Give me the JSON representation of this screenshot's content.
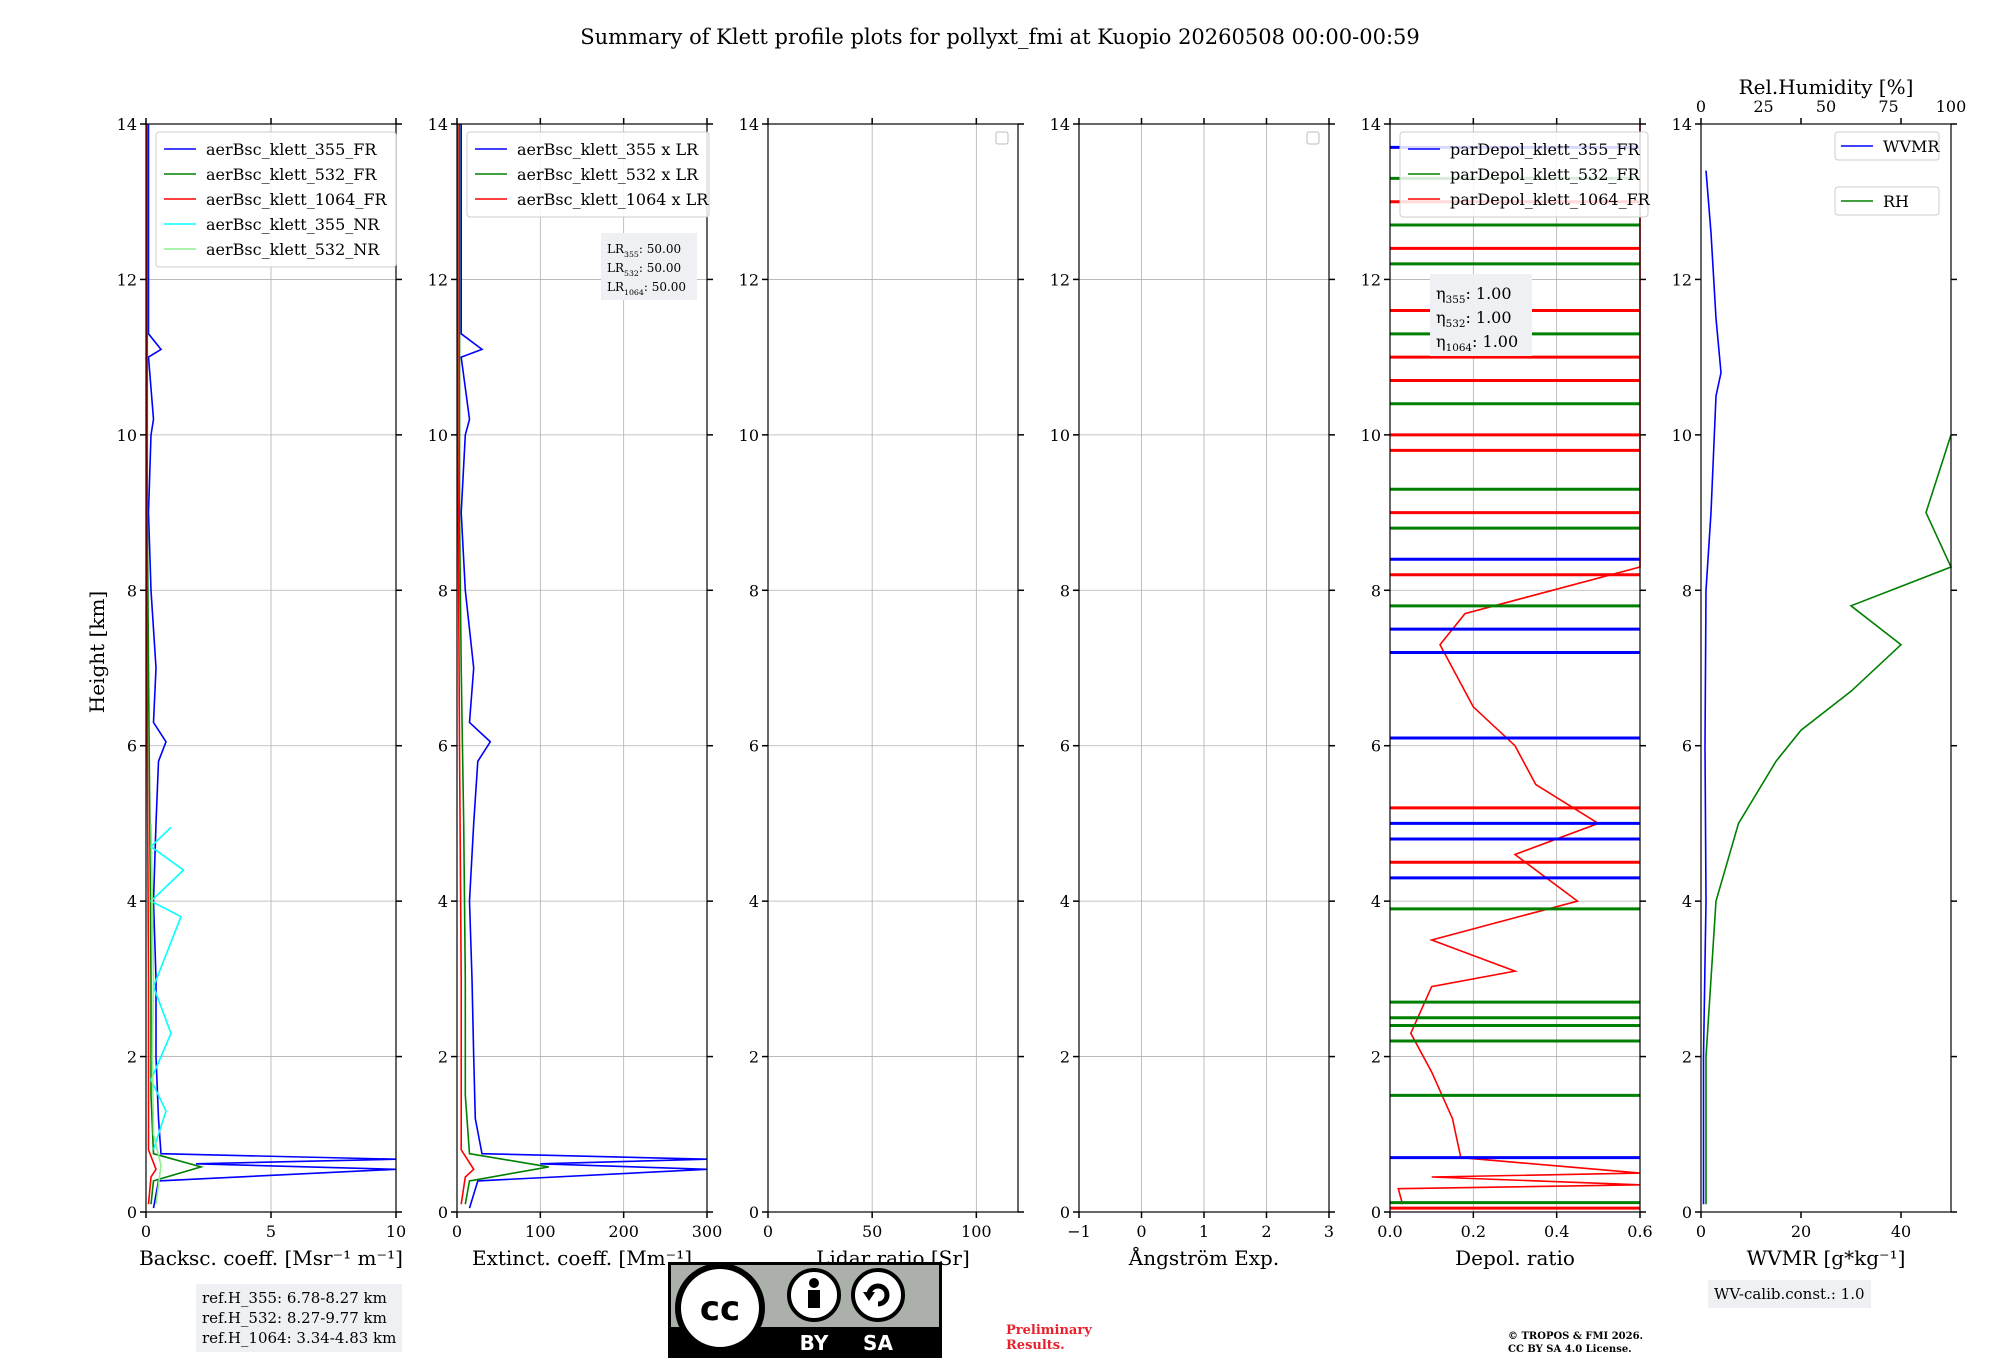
{
  "title": "Summary of Klett profile plots for pollyxt_fmi at Kuopio 20260508 00:00-00:59",
  "y_axis_label": "Height [km]",
  "y_ticks": [
    "0",
    "2",
    "4",
    "6",
    "8",
    "10",
    "12",
    "14"
  ],
  "panels": [
    {
      "id": "bsc",
      "xlabel": "Backsc. coeff. [Msr⁻¹ m⁻¹]",
      "xticks": [
        "0",
        "5",
        "10"
      ]
    },
    {
      "id": "ext",
      "xlabel": "Extinct. coeff. [Mm⁻¹]",
      "xticks": [
        "0",
        "100",
        "200",
        "300"
      ]
    },
    {
      "id": "lr",
      "xlabel": "Lidar ratio [Sr]",
      "xticks": [
        "0",
        "50",
        "100"
      ]
    },
    {
      "id": "ang",
      "xlabel": "Ångström Exp.",
      "xticks": [
        "−1",
        "0",
        "1",
        "2",
        "3"
      ]
    },
    {
      "id": "depol",
      "xlabel": "Depol. ratio",
      "xticks": [
        "0.0",
        "0.2",
        "0.4",
        "0.6"
      ]
    },
    {
      "id": "wv",
      "xlabel": "WVMR [g*kg⁻¹]",
      "xticks": [
        "0",
        "20",
        "40"
      ],
      "top_label": "Rel.Humidity [%]",
      "top_ticks": [
        "0",
        "25",
        "50",
        "75",
        "100"
      ]
    }
  ],
  "legends": {
    "bsc": [
      "aerBsc_klett_355_FR",
      "aerBsc_klett_532_FR",
      "aerBsc_klett_1064_FR",
      "aerBsc_klett_355_NR",
      "aerBsc_klett_532_NR"
    ],
    "ext": [
      "aerBsc_klett_355 x LR",
      "aerBsc_klett_532 x LR",
      "aerBsc_klett_1064 x LR"
    ],
    "depol": [
      "parDepol_klett_355_FR",
      "parDepol_klett_532_FR",
      "parDepol_klett_1064_FR"
    ],
    "wv": [
      "WVMR",
      "RH"
    ]
  },
  "annotations": {
    "lr_box": [
      "LR355: 50.00",
      "LR532: 50.00",
      "LR1064: 50.00"
    ],
    "eta_box": [
      "η355: 1.00",
      "η532: 1.00",
      "η1064: 1.00"
    ],
    "ref_box": [
      "ref.H_355: 6.78-8.27 km",
      "ref.H_532: 8.27-9.77 km",
      "ref.H_1064: 3.34-4.83 km"
    ],
    "wv_calib": "WV-calib.const.: 1.0",
    "preliminary": [
      "Preliminary",
      "Results."
    ],
    "copyright": [
      "© TROPOS & FMI 2026.",
      "CC BY SA 4.0 License."
    ],
    "license_badge": [
      "BY",
      "SA"
    ]
  },
  "colors": {
    "c355": "#0000ff",
    "c532": "#008000",
    "c1064": "#ff0000",
    "c355nr": "#00ffff",
    "c532nr": "#90ee90",
    "grid": "#b0b0b0",
    "infobox": "#eef0f4",
    "prelim": "#e8212c"
  },
  "chart_data": [
    {
      "type": "line",
      "panel": "bsc",
      "xlim": [
        0,
        10
      ],
      "ylim": [
        0,
        14
      ],
      "grid": true,
      "legend": "upper-left",
      "series": [
        {
          "name": "aerBsc_klett_355_FR",
          "points": [
            [
              0.3,
              0.05
            ],
            [
              0.5,
              0.4
            ],
            [
              10,
              0.55
            ],
            [
              2,
              0.62
            ],
            [
              10,
              0.68
            ],
            [
              0.6,
              0.75
            ],
            [
              0.5,
              1.2
            ],
            [
              0.4,
              2
            ],
            [
              0.4,
              3
            ],
            [
              0.3,
              4
            ],
            [
              0.4,
              5
            ],
            [
              0.5,
              5.8
            ],
            [
              0.8,
              6.05
            ],
            [
              0.3,
              6.3
            ],
            [
              0.4,
              7
            ],
            [
              0.2,
              8
            ],
            [
              0.1,
              9
            ],
            [
              0.2,
              10
            ],
            [
              0.3,
              10.2
            ],
            [
              0.1,
              11
            ],
            [
              0.6,
              11.1
            ],
            [
              0.1,
              11.3
            ],
            [
              0.1,
              12.5
            ],
            [
              0.1,
              14
            ]
          ]
        },
        {
          "name": "aerBsc_klett_532_FR",
          "points": [
            [
              0.2,
              0.1
            ],
            [
              0.3,
              0.4
            ],
            [
              2.2,
              0.58
            ],
            [
              0.3,
              0.75
            ],
            [
              0.2,
              1.5
            ],
            [
              0.2,
              3
            ],
            [
              0.15,
              5
            ],
            [
              0.1,
              7
            ],
            [
              0.05,
              9
            ],
            [
              0.05,
              14
            ]
          ]
        },
        {
          "name": "aerBsc_klett_1064_FR",
          "points": [
            [
              0.1,
              0.1
            ],
            [
              0.2,
              0.45
            ],
            [
              0.4,
              0.55
            ],
            [
              0.1,
              0.8
            ],
            [
              0.1,
              3
            ],
            [
              0.05,
              6
            ],
            [
              0.02,
              10
            ],
            [
              0.02,
              14
            ]
          ]
        },
        {
          "name": "aerBsc_klett_355_NR",
          "points": [
            [
              0.3,
              0.8
            ],
            [
              0.8,
              1.3
            ],
            [
              0.2,
              1.7
            ],
            [
              1,
              2.3
            ],
            [
              0.3,
              2.9
            ],
            [
              1.4,
              3.8
            ],
            [
              0.2,
              4
            ],
            [
              1.5,
              4.4
            ],
            [
              0.2,
              4.7
            ],
            [
              1,
              4.95
            ]
          ]
        },
        {
          "name": "aerBsc_klett_532_NR",
          "points": [
            [
              0.4,
              0.1
            ],
            [
              0.6,
              0.6
            ],
            [
              0.3,
              1.0
            ],
            [
              0.25,
              2
            ],
            [
              0.3,
              3
            ],
            [
              0.25,
              4
            ],
            [
              0.2,
              5
            ]
          ]
        }
      ]
    },
    {
      "type": "line",
      "panel": "ext",
      "xlim": [
        0,
        300
      ],
      "ylim": [
        0,
        14
      ],
      "grid": true,
      "legend": "upper-left",
      "series": [
        {
          "name": "aerBsc_klett_355 x LR",
          "points": [
            [
              15,
              0.05
            ],
            [
              25,
              0.4
            ],
            [
              300,
              0.55
            ],
            [
              100,
              0.62
            ],
            [
              300,
              0.68
            ],
            [
              30,
              0.75
            ],
            [
              22,
              1.2
            ],
            [
              20,
              2
            ],
            [
              18,
              3
            ],
            [
              15,
              4
            ],
            [
              20,
              5
            ],
            [
              25,
              5.8
            ],
            [
              40,
              6.05
            ],
            [
              15,
              6.3
            ],
            [
              20,
              7
            ],
            [
              10,
              8
            ],
            [
              5,
              9
            ],
            [
              10,
              10
            ],
            [
              15,
              10.2
            ],
            [
              5,
              11
            ],
            [
              30,
              11.1
            ],
            [
              5,
              11.3
            ],
            [
              5,
              12.5
            ],
            [
              5,
              14
            ]
          ]
        },
        {
          "name": "aerBsc_klett_532 x LR",
          "points": [
            [
              10,
              0.1
            ],
            [
              15,
              0.4
            ],
            [
              110,
              0.58
            ],
            [
              15,
              0.75
            ],
            [
              10,
              1.5
            ],
            [
              10,
              3
            ],
            [
              8,
              5
            ],
            [
              5,
              7
            ],
            [
              3,
              9
            ],
            [
              3,
              14
            ]
          ]
        },
        {
          "name": "aerBsc_klett_1064 x LR",
          "points": [
            [
              5,
              0.1
            ],
            [
              10,
              0.45
            ],
            [
              20,
              0.55
            ],
            [
              5,
              0.8
            ],
            [
              5,
              3
            ],
            [
              3,
              6
            ],
            [
              1,
              10
            ],
            [
              1,
              14
            ]
          ]
        }
      ]
    },
    {
      "type": "line",
      "panel": "lr",
      "xlim": [
        0,
        120
      ],
      "ylim": [
        0,
        14
      ],
      "grid": true,
      "series": []
    },
    {
      "type": "line",
      "panel": "ang",
      "xlim": [
        -1,
        3
      ],
      "ylim": [
        0,
        14
      ],
      "grid": true,
      "series": []
    },
    {
      "type": "line",
      "panel": "depol",
      "xlim": [
        0,
        0.6
      ],
      "ylim": [
        0,
        14
      ],
      "grid": true,
      "legend": "upper-left",
      "series": [
        {
          "name": "parDepol_klett_1064_FR",
          "points": [
            [
              0.03,
              0.1
            ],
            [
              0.02,
              0.3
            ],
            [
              0.6,
              0.35
            ],
            [
              0.1,
              0.45
            ],
            [
              0.6,
              0.5
            ],
            [
              0.17,
              0.7
            ],
            [
              0.15,
              1.2
            ],
            [
              0.1,
              1.8
            ],
            [
              0.05,
              2.3
            ],
            [
              0.1,
              2.9
            ],
            [
              0.3,
              3.1
            ],
            [
              0.1,
              3.5
            ],
            [
              0.45,
              4
            ],
            [
              0.3,
              4.6
            ],
            [
              0.5,
              5
            ],
            [
              0.35,
              5.5
            ],
            [
              0.3,
              6
            ],
            [
              0.2,
              6.5
            ],
            [
              0.12,
              7.3
            ],
            [
              0.18,
              7.7
            ],
            [
              0.6,
              8.3
            ],
            [
              0.6,
              14
            ]
          ]
        }
      ]
    },
    {
      "type": "line",
      "panel": "wv",
      "xlim": [
        0,
        50
      ],
      "ylim": [
        0,
        14
      ],
      "top_xlim": [
        0,
        100
      ],
      "grid": false,
      "legend": "upper-right",
      "series": [
        {
          "name": "WVMR",
          "points": [
            [
              0.5,
              0.1
            ],
            [
              0.5,
              2
            ],
            [
              1,
              4
            ],
            [
              0.8,
              6
            ],
            [
              1,
              8
            ],
            [
              2,
              9
            ],
            [
              3,
              10.5
            ],
            [
              4,
              10.8
            ],
            [
              3,
              11.5
            ],
            [
              2,
              12.6
            ],
            [
              1,
              13.4
            ]
          ]
        },
        {
          "name": "RH",
          "points": [
            [
              2,
              0.1
            ],
            [
              2,
              2
            ],
            [
              4,
              3
            ],
            [
              6,
              4
            ],
            [
              15,
              5
            ],
            [
              30,
              5.8
            ],
            [
              40,
              6.2
            ],
            [
              60,
              6.7
            ],
            [
              80,
              7.3
            ],
            [
              60,
              7.8
            ],
            [
              100,
              8.3
            ],
            [
              90,
              9
            ],
            [
              100,
              10
            ]
          ]
        }
      ]
    }
  ]
}
